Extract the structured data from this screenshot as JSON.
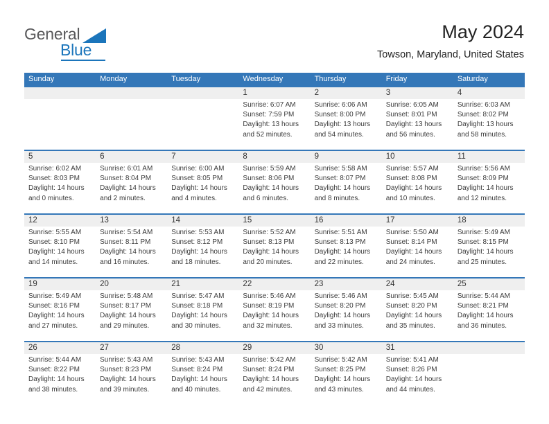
{
  "brand": {
    "name_part1": "General",
    "name_part2": "Blue",
    "triangle_icon": "blue-triangle-icon",
    "accent_color": "#1b75bb"
  },
  "header": {
    "month_title": "May 2024",
    "location": "Towson, Maryland, United States"
  },
  "theme": {
    "header_bar_color": "#3477b8",
    "band_color": "#efefef",
    "text_color": "#3b3b3b"
  },
  "calendar": {
    "weekday_headers": [
      "Sunday",
      "Monday",
      "Tuesday",
      "Wednesday",
      "Thursday",
      "Friday",
      "Saturday"
    ],
    "weeks": [
      [
        {
          "day": "",
          "sunrise": "",
          "sunset": "",
          "daylight_line1": "",
          "daylight_line2": ""
        },
        {
          "day": "",
          "sunrise": "",
          "sunset": "",
          "daylight_line1": "",
          "daylight_line2": ""
        },
        {
          "day": "",
          "sunrise": "",
          "sunset": "",
          "daylight_line1": "",
          "daylight_line2": ""
        },
        {
          "day": "1",
          "sunrise": "Sunrise: 6:07 AM",
          "sunset": "Sunset: 7:59 PM",
          "daylight_line1": "Daylight: 13 hours",
          "daylight_line2": "and 52 minutes."
        },
        {
          "day": "2",
          "sunrise": "Sunrise: 6:06 AM",
          "sunset": "Sunset: 8:00 PM",
          "daylight_line1": "Daylight: 13 hours",
          "daylight_line2": "and 54 minutes."
        },
        {
          "day": "3",
          "sunrise": "Sunrise: 6:05 AM",
          "sunset": "Sunset: 8:01 PM",
          "daylight_line1": "Daylight: 13 hours",
          "daylight_line2": "and 56 minutes."
        },
        {
          "day": "4",
          "sunrise": "Sunrise: 6:03 AM",
          "sunset": "Sunset: 8:02 PM",
          "daylight_line1": "Daylight: 13 hours",
          "daylight_line2": "and 58 minutes."
        }
      ],
      [
        {
          "day": "5",
          "sunrise": "Sunrise: 6:02 AM",
          "sunset": "Sunset: 8:03 PM",
          "daylight_line1": "Daylight: 14 hours",
          "daylight_line2": "and 0 minutes."
        },
        {
          "day": "6",
          "sunrise": "Sunrise: 6:01 AM",
          "sunset": "Sunset: 8:04 PM",
          "daylight_line1": "Daylight: 14 hours",
          "daylight_line2": "and 2 minutes."
        },
        {
          "day": "7",
          "sunrise": "Sunrise: 6:00 AM",
          "sunset": "Sunset: 8:05 PM",
          "daylight_line1": "Daylight: 14 hours",
          "daylight_line2": "and 4 minutes."
        },
        {
          "day": "8",
          "sunrise": "Sunrise: 5:59 AM",
          "sunset": "Sunset: 8:06 PM",
          "daylight_line1": "Daylight: 14 hours",
          "daylight_line2": "and 6 minutes."
        },
        {
          "day": "9",
          "sunrise": "Sunrise: 5:58 AM",
          "sunset": "Sunset: 8:07 PM",
          "daylight_line1": "Daylight: 14 hours",
          "daylight_line2": "and 8 minutes."
        },
        {
          "day": "10",
          "sunrise": "Sunrise: 5:57 AM",
          "sunset": "Sunset: 8:08 PM",
          "daylight_line1": "Daylight: 14 hours",
          "daylight_line2": "and 10 minutes."
        },
        {
          "day": "11",
          "sunrise": "Sunrise: 5:56 AM",
          "sunset": "Sunset: 8:09 PM",
          "daylight_line1": "Daylight: 14 hours",
          "daylight_line2": "and 12 minutes."
        }
      ],
      [
        {
          "day": "12",
          "sunrise": "Sunrise: 5:55 AM",
          "sunset": "Sunset: 8:10 PM",
          "daylight_line1": "Daylight: 14 hours",
          "daylight_line2": "and 14 minutes."
        },
        {
          "day": "13",
          "sunrise": "Sunrise: 5:54 AM",
          "sunset": "Sunset: 8:11 PM",
          "daylight_line1": "Daylight: 14 hours",
          "daylight_line2": "and 16 minutes."
        },
        {
          "day": "14",
          "sunrise": "Sunrise: 5:53 AM",
          "sunset": "Sunset: 8:12 PM",
          "daylight_line1": "Daylight: 14 hours",
          "daylight_line2": "and 18 minutes."
        },
        {
          "day": "15",
          "sunrise": "Sunrise: 5:52 AM",
          "sunset": "Sunset: 8:13 PM",
          "daylight_line1": "Daylight: 14 hours",
          "daylight_line2": "and 20 minutes."
        },
        {
          "day": "16",
          "sunrise": "Sunrise: 5:51 AM",
          "sunset": "Sunset: 8:13 PM",
          "daylight_line1": "Daylight: 14 hours",
          "daylight_line2": "and 22 minutes."
        },
        {
          "day": "17",
          "sunrise": "Sunrise: 5:50 AM",
          "sunset": "Sunset: 8:14 PM",
          "daylight_line1": "Daylight: 14 hours",
          "daylight_line2": "and 24 minutes."
        },
        {
          "day": "18",
          "sunrise": "Sunrise: 5:49 AM",
          "sunset": "Sunset: 8:15 PM",
          "daylight_line1": "Daylight: 14 hours",
          "daylight_line2": "and 25 minutes."
        }
      ],
      [
        {
          "day": "19",
          "sunrise": "Sunrise: 5:49 AM",
          "sunset": "Sunset: 8:16 PM",
          "daylight_line1": "Daylight: 14 hours",
          "daylight_line2": "and 27 minutes."
        },
        {
          "day": "20",
          "sunrise": "Sunrise: 5:48 AM",
          "sunset": "Sunset: 8:17 PM",
          "daylight_line1": "Daylight: 14 hours",
          "daylight_line2": "and 29 minutes."
        },
        {
          "day": "21",
          "sunrise": "Sunrise: 5:47 AM",
          "sunset": "Sunset: 8:18 PM",
          "daylight_line1": "Daylight: 14 hours",
          "daylight_line2": "and 30 minutes."
        },
        {
          "day": "22",
          "sunrise": "Sunrise: 5:46 AM",
          "sunset": "Sunset: 8:19 PM",
          "daylight_line1": "Daylight: 14 hours",
          "daylight_line2": "and 32 minutes."
        },
        {
          "day": "23",
          "sunrise": "Sunrise: 5:46 AM",
          "sunset": "Sunset: 8:20 PM",
          "daylight_line1": "Daylight: 14 hours",
          "daylight_line2": "and 33 minutes."
        },
        {
          "day": "24",
          "sunrise": "Sunrise: 5:45 AM",
          "sunset": "Sunset: 8:20 PM",
          "daylight_line1": "Daylight: 14 hours",
          "daylight_line2": "and 35 minutes."
        },
        {
          "day": "25",
          "sunrise": "Sunrise: 5:44 AM",
          "sunset": "Sunset: 8:21 PM",
          "daylight_line1": "Daylight: 14 hours",
          "daylight_line2": "and 36 minutes."
        }
      ],
      [
        {
          "day": "26",
          "sunrise": "Sunrise: 5:44 AM",
          "sunset": "Sunset: 8:22 PM",
          "daylight_line1": "Daylight: 14 hours",
          "daylight_line2": "and 38 minutes."
        },
        {
          "day": "27",
          "sunrise": "Sunrise: 5:43 AM",
          "sunset": "Sunset: 8:23 PM",
          "daylight_line1": "Daylight: 14 hours",
          "daylight_line2": "and 39 minutes."
        },
        {
          "day": "28",
          "sunrise": "Sunrise: 5:43 AM",
          "sunset": "Sunset: 8:24 PM",
          "daylight_line1": "Daylight: 14 hours",
          "daylight_line2": "and 40 minutes."
        },
        {
          "day": "29",
          "sunrise": "Sunrise: 5:42 AM",
          "sunset": "Sunset: 8:24 PM",
          "daylight_line1": "Daylight: 14 hours",
          "daylight_line2": "and 42 minutes."
        },
        {
          "day": "30",
          "sunrise": "Sunrise: 5:42 AM",
          "sunset": "Sunset: 8:25 PM",
          "daylight_line1": "Daylight: 14 hours",
          "daylight_line2": "and 43 minutes."
        },
        {
          "day": "31",
          "sunrise": "Sunrise: 5:41 AM",
          "sunset": "Sunset: 8:26 PM",
          "daylight_line1": "Daylight: 14 hours",
          "daylight_line2": "and 44 minutes."
        },
        {
          "day": "",
          "sunrise": "",
          "sunset": "",
          "daylight_line1": "",
          "daylight_line2": ""
        }
      ]
    ]
  }
}
